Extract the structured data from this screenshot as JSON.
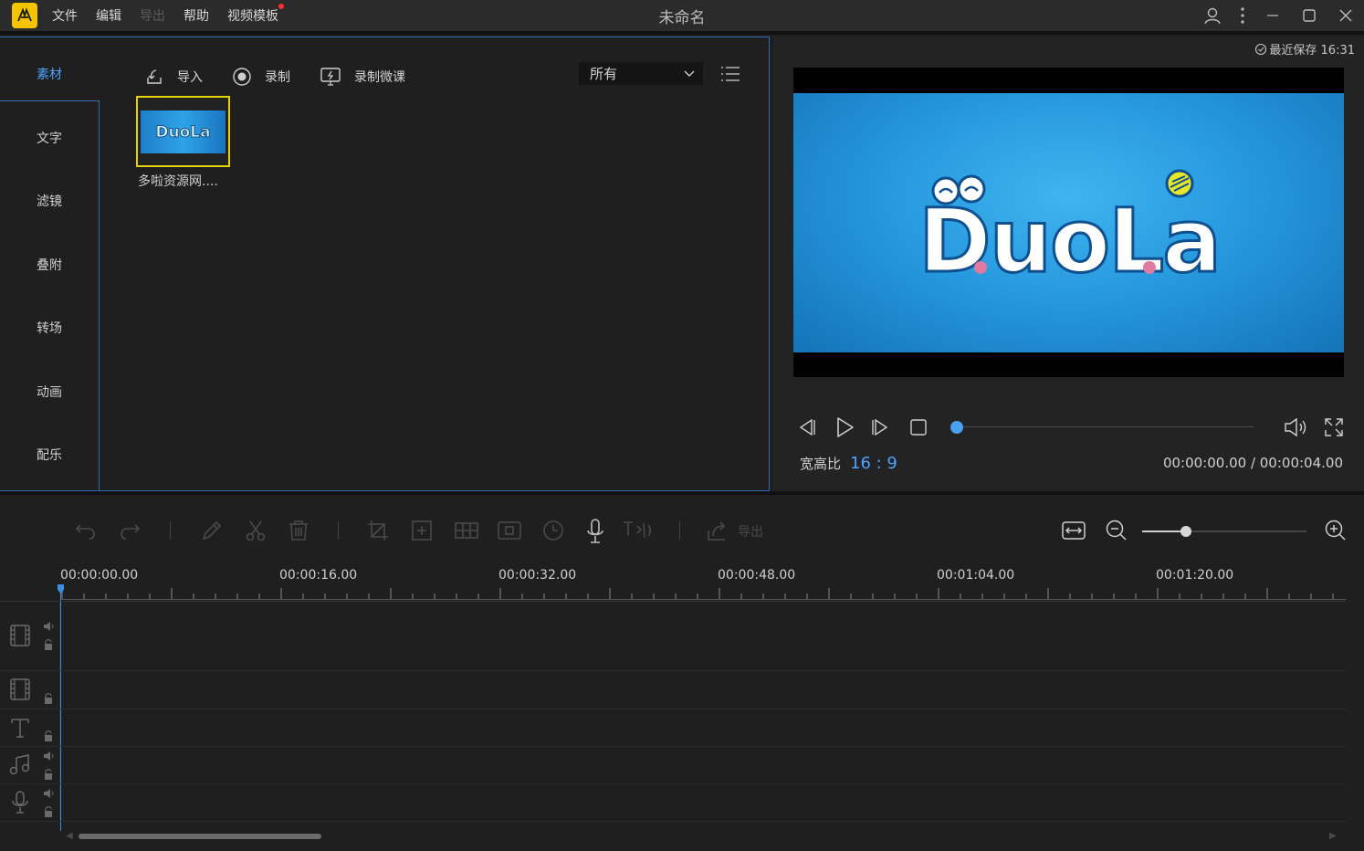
{
  "app": {
    "title": "未命名",
    "menu": [
      {
        "label": "文件",
        "enabled": true
      },
      {
        "label": "编辑",
        "enabled": true
      },
      {
        "label": "导出",
        "enabled": false
      },
      {
        "label": "帮助",
        "enabled": true
      },
      {
        "label": "视频模板",
        "enabled": true,
        "badge": true
      }
    ],
    "accent_color": "#4ea3ff",
    "logo_color": "#f5c400"
  },
  "sidebar": {
    "items": [
      {
        "label": "素材",
        "active": true
      },
      {
        "label": "文字",
        "active": false
      },
      {
        "label": "滤镜",
        "active": false
      },
      {
        "label": "叠附",
        "active": false
      },
      {
        "label": "转场",
        "active": false
      },
      {
        "label": "动画",
        "active": false
      },
      {
        "label": "配乐",
        "active": false
      }
    ]
  },
  "media_toolbar": {
    "import_label": "导入",
    "record_label": "录制",
    "record_lesson_label": "录制微课",
    "filter_value": "所有"
  },
  "media_items": [
    {
      "label": "多啦资源网....",
      "thumb_text": "DuoLa"
    }
  ],
  "preview": {
    "save_status": "最近保存 16:31",
    "video_logo_text": "DuoLa",
    "aspect_label": "宽高比",
    "aspect_value": "16 : 9",
    "timecode": "00:00:00.00 / 00:00:04.00",
    "progress": 0.0
  },
  "timeline": {
    "export_label": "导出",
    "zoom_level": 0.27,
    "ruler_labels": [
      "00:00:00.00",
      "00:00:16.00",
      "00:00:32.00",
      "00:00:48.00",
      "00:01:04.00",
      "00:01:20.00"
    ]
  }
}
